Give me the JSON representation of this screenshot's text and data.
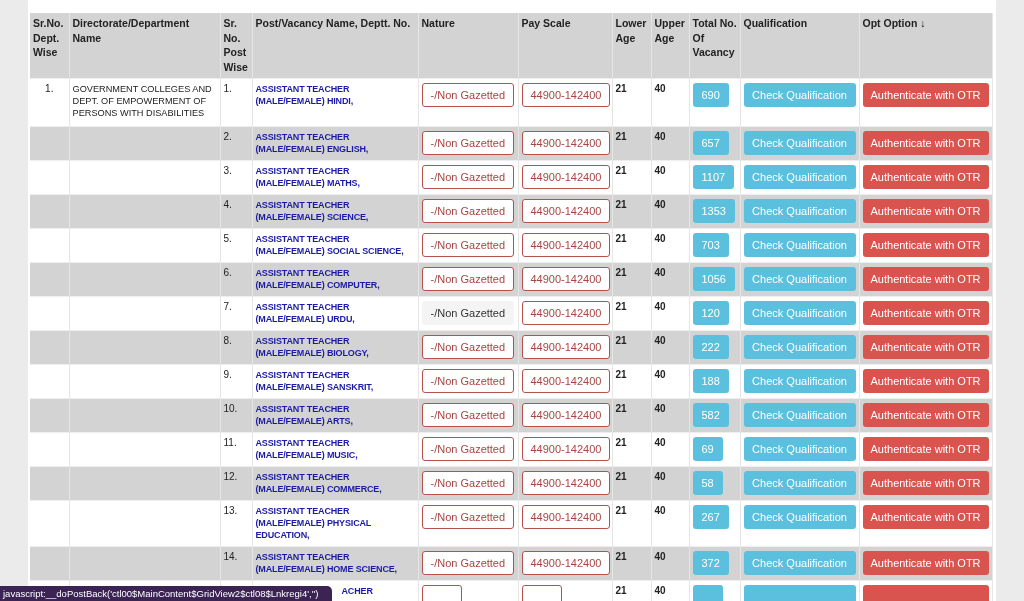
{
  "table": {
    "columns": [
      "Sr.No. Dept. Wise",
      "Directorate/Department Name",
      "Sr. No. Post Wise",
      "Post/Vacancy Name, Deptt. No.",
      "Nature",
      "Pay Scale",
      "Lower Age",
      "Upper Age",
      "Total No. Of Vacancy",
      "Qualification",
      "Opt Option ↓"
    ],
    "rows": [
      {
        "dept_sr": "1.",
        "department": "GOVERNMENT COLLEGES AND DEPT. OF EMPOWERMENT OF PERSONS WITH DISABILITIES",
        "post_sr": "1.",
        "post": "ASSISTANT TEACHER (MALE/FEMALE) HINDI,",
        "nature": "-/Non Gazetted",
        "nature_outlined": true,
        "pay_scale": "44900-142400",
        "lower_age": "21",
        "upper_age": "40",
        "vacancy": "690",
        "qualification": "Check Qualification",
        "action": "Authenticate with OTR"
      },
      {
        "post_sr": "2.",
        "post": "ASSISTANT TEACHER (MALE/FEMALE) ENGLISH,",
        "nature": "-/Non Gazetted",
        "nature_outlined": true,
        "pay_scale": "44900-142400",
        "lower_age": "21",
        "upper_age": "40",
        "vacancy": "657",
        "qualification": "Check Qualification",
        "action": "Authenticate with OTR"
      },
      {
        "post_sr": "3.",
        "post": "ASSISTANT TEACHER (MALE/FEMALE) MATHS,",
        "nature": "-/Non Gazetted",
        "nature_outlined": true,
        "pay_scale": "44900-142400",
        "lower_age": "21",
        "upper_age": "40",
        "vacancy": "1107",
        "qualification": "Check Qualification",
        "action": "Authenticate with OTR"
      },
      {
        "post_sr": "4.",
        "post": "ASSISTANT TEACHER (MALE/FEMALE) SCIENCE,",
        "nature": "-/Non Gazetted",
        "nature_outlined": true,
        "pay_scale": "44900-142400",
        "lower_age": "21",
        "upper_age": "40",
        "vacancy": "1353",
        "qualification": "Check Qualification",
        "action": "Authenticate with OTR"
      },
      {
        "post_sr": "5.",
        "post": "ASSISTANT TEACHER (MALE/FEMALE) SOCIAL SCIENCE,",
        "nature": "-/Non Gazetted",
        "nature_outlined": true,
        "pay_scale": "44900-142400",
        "lower_age": "21",
        "upper_age": "40",
        "vacancy": "703",
        "qualification": "Check Qualification",
        "action": "Authenticate with OTR"
      },
      {
        "post_sr": "6.",
        "post": "ASSISTANT TEACHER (MALE/FEMALE) COMPUTER,",
        "nature": "-/Non Gazetted",
        "nature_outlined": true,
        "pay_scale": "44900-142400",
        "lower_age": "21",
        "upper_age": "40",
        "vacancy": "1056",
        "qualification": "Check Qualification",
        "action": "Authenticate with OTR"
      },
      {
        "post_sr": "7.",
        "post": "ASSISTANT TEACHER (MALE/FEMALE) URDU,",
        "nature": "-/Non Gazetted",
        "nature_outlined": false,
        "pay_scale": "44900-142400",
        "lower_age": "21",
        "upper_age": "40",
        "vacancy": "120",
        "qualification": "Check Qualification",
        "action": "Authenticate with OTR"
      },
      {
        "post_sr": "8.",
        "post": "ASSISTANT TEACHER (MALE/FEMALE) BIOLOGY,",
        "nature": "-/Non Gazetted",
        "nature_outlined": true,
        "pay_scale": "44900-142400",
        "lower_age": "21",
        "upper_age": "40",
        "vacancy": "222",
        "qualification": "Check Qualification",
        "action": "Authenticate with OTR"
      },
      {
        "post_sr": "9.",
        "post": "ASSISTANT TEACHER (MALE/FEMALE) SANSKRIT,",
        "nature": "-/Non Gazetted",
        "nature_outlined": true,
        "pay_scale": "44900-142400",
        "lower_age": "21",
        "upper_age": "40",
        "vacancy": "188",
        "qualification": "Check Qualification",
        "action": "Authenticate with OTR"
      },
      {
        "post_sr": "10.",
        "post": "ASSISTANT TEACHER (MALE/FEMALE) ARTS,",
        "nature": "-/Non Gazetted",
        "nature_outlined": true,
        "pay_scale": "44900-142400",
        "lower_age": "21",
        "upper_age": "40",
        "vacancy": "582",
        "qualification": "Check Qualification",
        "action": "Authenticate with OTR"
      },
      {
        "post_sr": "11.",
        "post": "ASSISTANT TEACHER (MALE/FEMALE) MUSIC,",
        "nature": "-/Non Gazetted",
        "nature_outlined": true,
        "pay_scale": "44900-142400",
        "lower_age": "21",
        "upper_age": "40",
        "vacancy": "69",
        "qualification": "Check Qualification",
        "action": "Authenticate with OTR"
      },
      {
        "post_sr": "12.",
        "post": "ASSISTANT TEACHER (MALE/FEMALE) COMMERCE,",
        "nature": "-/Non Gazetted",
        "nature_outlined": true,
        "pay_scale": "44900-142400",
        "lower_age": "21",
        "upper_age": "40",
        "vacancy": "58",
        "qualification": "Check Qualification",
        "action": "Authenticate with OTR"
      },
      {
        "post_sr": "13.",
        "post": "ASSISTANT TEACHER (MALE/FEMALE) PHYSICAL EDUCATION,",
        "nature": "-/Non Gazetted",
        "nature_outlined": true,
        "pay_scale": "44900-142400",
        "lower_age": "21",
        "upper_age": "40",
        "vacancy": "267",
        "qualification": "Check Qualification",
        "action": "Authenticate with OTR"
      },
      {
        "post_sr": "14.",
        "post": "ASSISTANT TEACHER (MALE/FEMALE) HOME SCIENCE,",
        "nature": "-/Non Gazetted",
        "nature_outlined": true,
        "pay_scale": "44900-142400",
        "lower_age": "21",
        "upper_age": "40",
        "vacancy": "372",
        "qualification": "Check Qualification",
        "action": "Authenticate with OTR"
      },
      {
        "post": "ACHER",
        "nature_outlined": true,
        "lower_age": "21",
        "upper_age": "40"
      }
    ]
  },
  "status_bar": {
    "text": "javascript:__doPostBack('ctl00$MainContent$GridView2$ctl08$Lnkregi4','')"
  }
}
